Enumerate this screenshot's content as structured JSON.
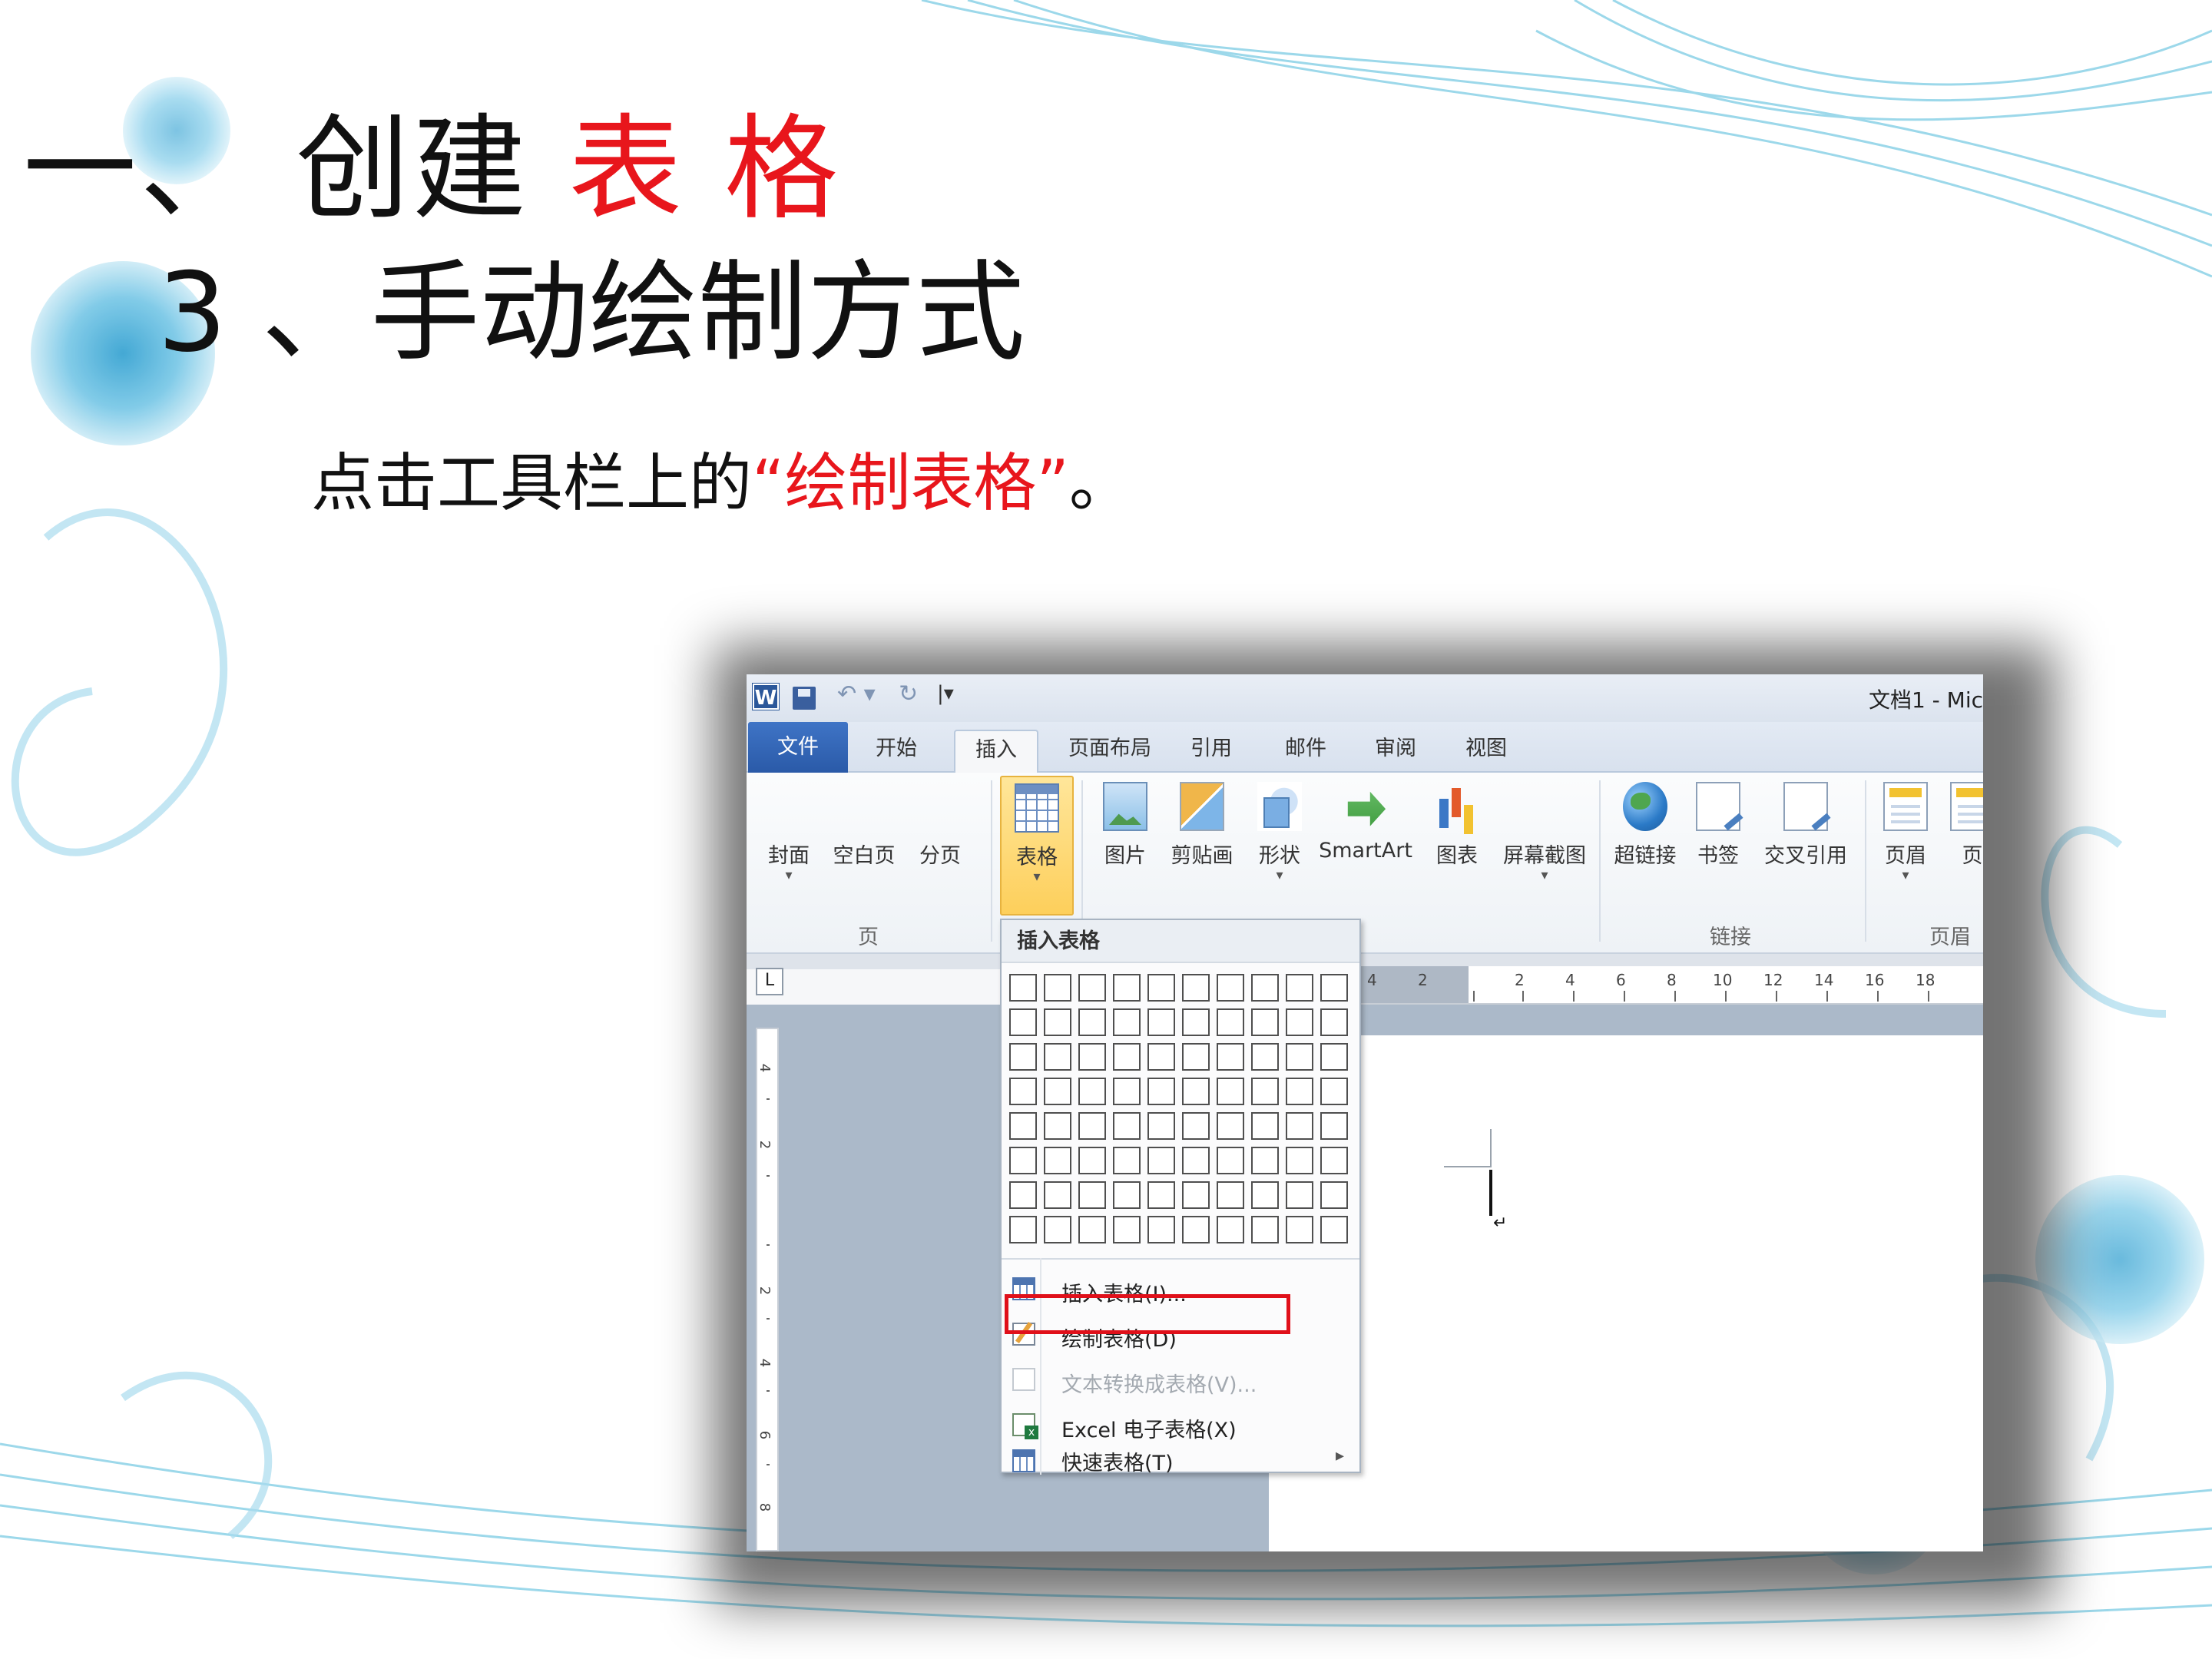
{
  "slide": {
    "title_prefix": "一、 创建",
    "title_highlight": "表 格",
    "subtitle": "3 、手动绘制方式",
    "instruction_before": "点击工具栏上的",
    "instruction_highlight": "“绘制表格”",
    "instruction_after": "。",
    "accent_color": "#e8161c"
  },
  "window": {
    "app_icon": "W",
    "doc_title": "文档1 - Mic",
    "qat_icons": [
      "word-icon",
      "save-icon",
      "undo-icon",
      "redo-icon",
      "customize-icon"
    ]
  },
  "tabs": [
    "文件",
    "开始",
    "插入",
    "页面布局",
    "引用",
    "邮件",
    "审阅",
    "视图"
  ],
  "active_tab": "插入",
  "ribbon": {
    "pages_group": {
      "label": "页",
      "buttons": [
        "封面",
        "空白页",
        "分页"
      ]
    },
    "table_button": "表格",
    "illustrations": [
      "图片",
      "剪贴画",
      "形状",
      "SmartArt",
      "图表",
      "屏幕截图"
    ],
    "links_group": {
      "label": "链接",
      "buttons": [
        "超链接",
        "书签",
        "交叉引用"
      ]
    },
    "header_group": {
      "label": "页眉和",
      "buttons": [
        "页眉",
        "页"
      ]
    }
  },
  "ruler": {
    "horizontal": [
      "4",
      "2",
      "2",
      "4",
      "6",
      "8",
      "10",
      "12",
      "14",
      "16",
      "18"
    ],
    "vertical": [
      "4",
      "2",
      "2",
      "4",
      "6",
      "8"
    ],
    "tab_selector": "L"
  },
  "dropdown": {
    "header": "插入表格",
    "grid_columns": 10,
    "grid_rows": 8,
    "items": [
      {
        "label": "插入表格(I)...",
        "icon": "table-icon",
        "enabled": true
      },
      {
        "label": "绘制表格(D)",
        "icon": "pencil-icon",
        "enabled": true,
        "highlighted": true
      },
      {
        "label": "文本转换成表格(V)...",
        "icon": "convert-icon",
        "enabled": false
      },
      {
        "label": "Excel 电子表格(X)",
        "icon": "excel-icon",
        "enabled": true
      },
      {
        "label": "快速表格(T)",
        "icon": "table-icon",
        "enabled": true,
        "submenu": true
      }
    ]
  }
}
